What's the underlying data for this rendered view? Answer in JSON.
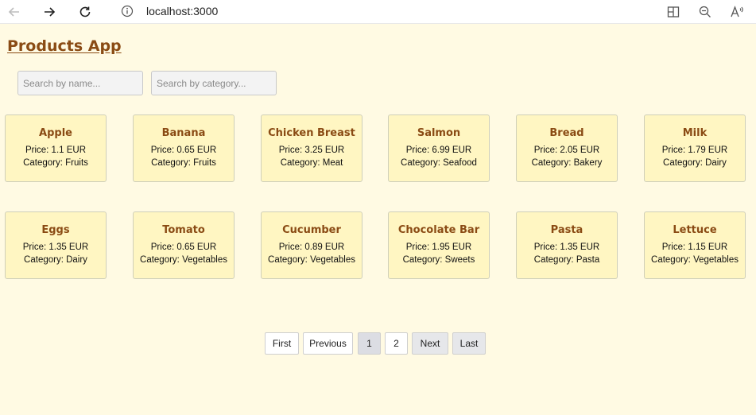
{
  "browser": {
    "url": "localhost:3000"
  },
  "app": {
    "title": "Products App"
  },
  "search": {
    "name_placeholder": "Search by name...",
    "category_placeholder": "Search by category..."
  },
  "products": [
    {
      "name": "Apple",
      "price": "Price: 1.1 EUR",
      "category": "Category: Fruits"
    },
    {
      "name": "Banana",
      "price": "Price: 0.65 EUR",
      "category": "Category: Fruits"
    },
    {
      "name": "Chicken Breast",
      "price": "Price: 3.25 EUR",
      "category": "Category: Meat"
    },
    {
      "name": "Salmon",
      "price": "Price: 6.99 EUR",
      "category": "Category: Seafood"
    },
    {
      "name": "Bread",
      "price": "Price: 2.05 EUR",
      "category": "Category: Bakery"
    },
    {
      "name": "Milk",
      "price": "Price: 1.79 EUR",
      "category": "Category: Dairy"
    },
    {
      "name": "Eggs",
      "price": "Price: 1.35 EUR",
      "category": "Category: Dairy"
    },
    {
      "name": "Tomato",
      "price": "Price: 0.65 EUR",
      "category": "Category: Vegetables"
    },
    {
      "name": "Cucumber",
      "price": "Price: 0.89 EUR",
      "category": "Category: Vegetables"
    },
    {
      "name": "Chocolate Bar",
      "price": "Price: 1.95 EUR",
      "category": "Category: Sweets"
    },
    {
      "name": "Pasta",
      "price": "Price: 1.35 EUR",
      "category": "Category: Pasta"
    },
    {
      "name": "Lettuce",
      "price": "Price: 1.15 EUR",
      "category": "Category: Vegetables"
    }
  ],
  "pagination": {
    "first": "First",
    "previous": "Previous",
    "page1": "1",
    "page2": "2",
    "next": "Next",
    "last": "Last",
    "current_page": 1
  },
  "colors": {
    "page_background": "#fffae3",
    "card_background": "#fff6c2",
    "accent_brown": "#8a4b14"
  },
  "icons": [
    "back-arrow-icon",
    "forward-arrow-icon",
    "refresh-icon",
    "info-icon",
    "split-screen-icon",
    "zoom-out-icon",
    "read-aloud-icon"
  ]
}
